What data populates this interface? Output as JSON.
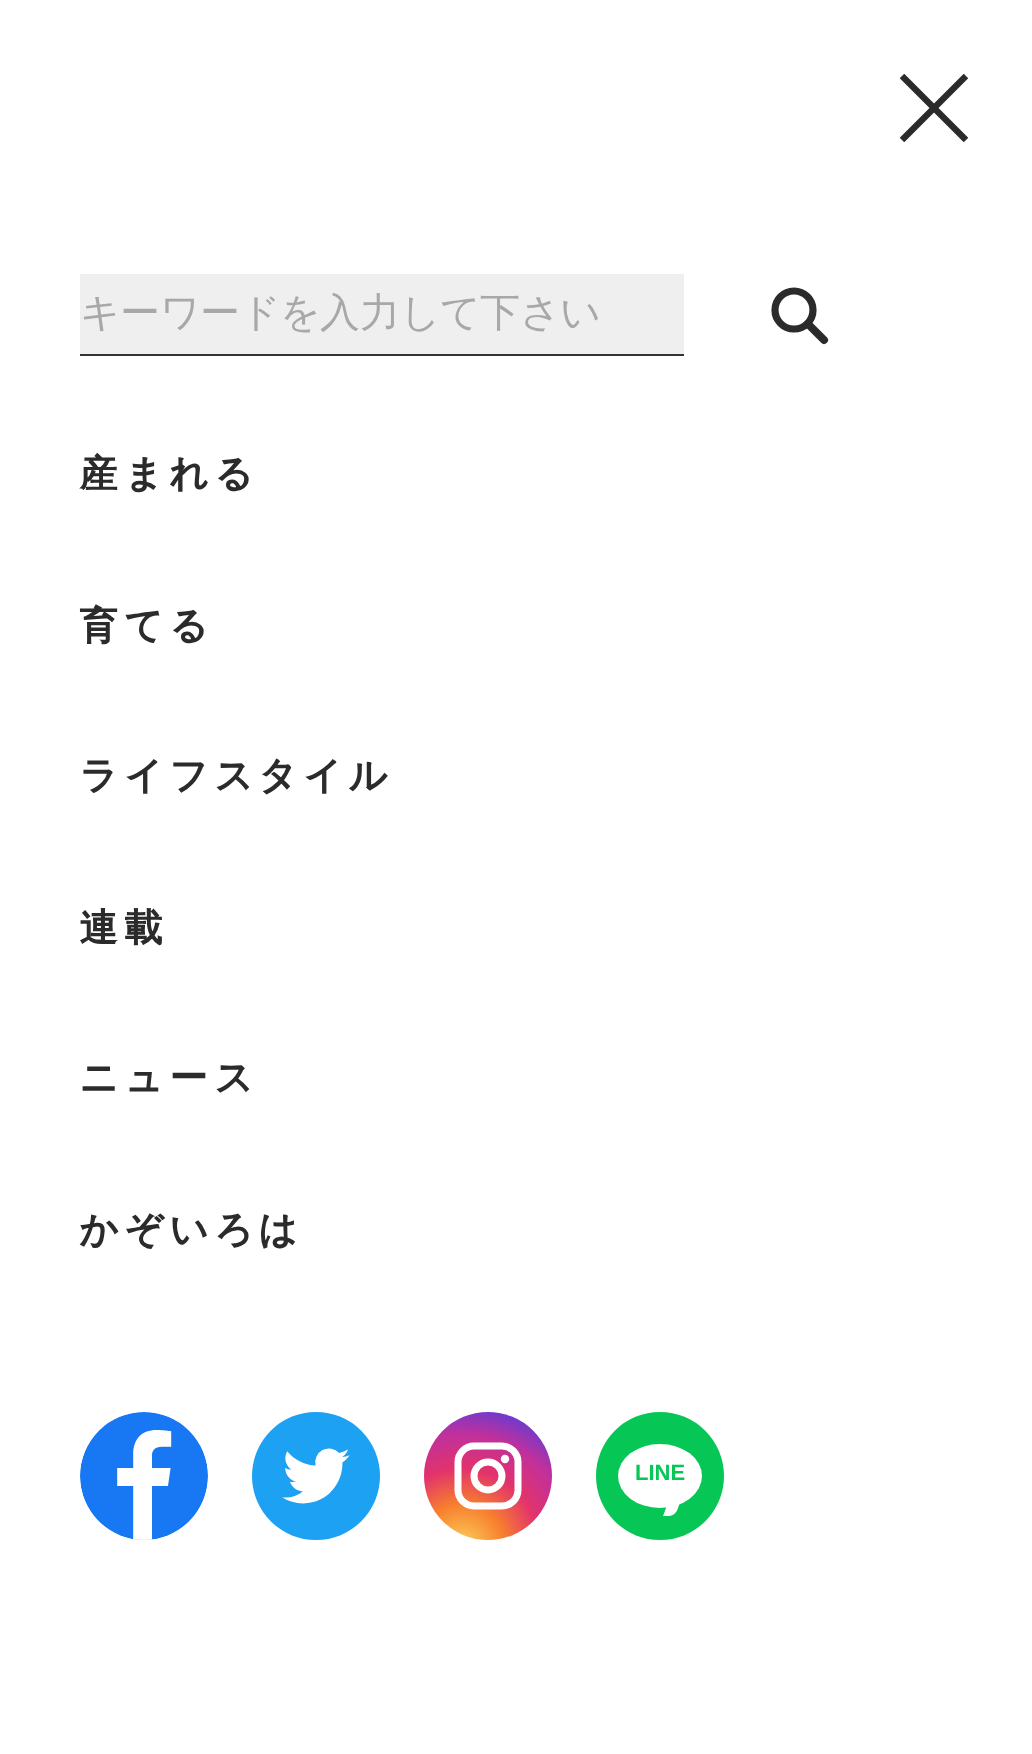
{
  "search": {
    "placeholder": "キーワードを入力して下さい"
  },
  "menu": [
    {
      "label": "産まれる"
    },
    {
      "label": "育てる"
    },
    {
      "label": "ライフスタイル"
    },
    {
      "label": "連載"
    },
    {
      "label": "ニュース"
    },
    {
      "label": "かぞいろは"
    }
  ],
  "social": [
    {
      "kind": "facebook"
    },
    {
      "kind": "twitter"
    },
    {
      "kind": "instagram"
    },
    {
      "kind": "line",
      "label": "LINE"
    }
  ]
}
